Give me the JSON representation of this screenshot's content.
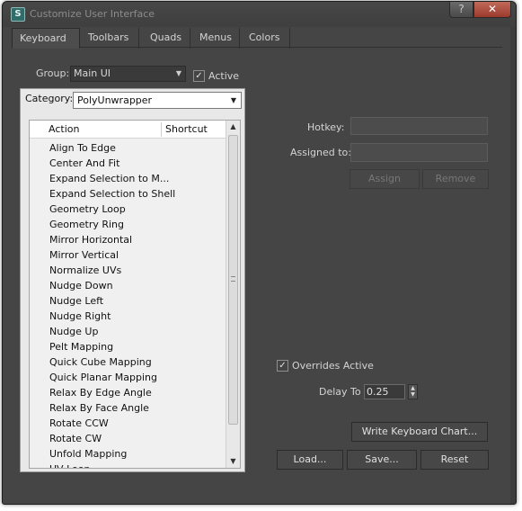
{
  "window": {
    "title": "Customize User Interface",
    "help_label": "?",
    "close_label": "✕"
  },
  "tabs": [
    "Keyboard",
    "Toolbars",
    "Quads",
    "Menus",
    "Colors"
  ],
  "group": {
    "label": "Group:",
    "value": "Main UI",
    "active_label": "Active",
    "active_checked": true
  },
  "category": {
    "label": "Category:",
    "value": "PolyUnwrapper"
  },
  "action_list": {
    "columns": [
      "Action",
      "Shortcut"
    ],
    "rows": [
      "Align To Edge",
      "Center And Fit",
      "Expand Selection to M...",
      "Expand Selection to Shell",
      "Geometry Loop",
      "Geometry Ring",
      "Mirror Horizontal",
      "Mirror Vertical",
      "Normalize UVs",
      "Nudge Down",
      "Nudge Left",
      "Nudge Right",
      "Nudge Up",
      "Pelt Mapping",
      "Quick Cube Mapping",
      "Quick Planar Mapping",
      "Relax By Edge Angle",
      "Relax By Face Angle",
      "Rotate CCW",
      "Rotate CW",
      "Unfold Mapping",
      "UV Loop"
    ]
  },
  "hotkey": {
    "label": "Hotkey:",
    "value": ""
  },
  "assigned_to": {
    "label": "Assigned to:",
    "value": ""
  },
  "buttons": {
    "assign": "Assign",
    "remove": "Remove",
    "write_chart": "Write Keyboard Chart...",
    "load": "Load...",
    "save": "Save...",
    "reset": "Reset"
  },
  "overrides": {
    "label": "Overrides Active",
    "checked": true
  },
  "delay": {
    "label": "Delay To",
    "value": "0.25"
  }
}
